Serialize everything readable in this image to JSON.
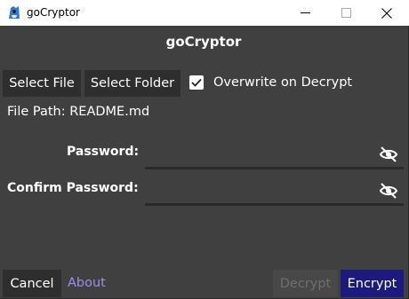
{
  "window": {
    "title": "goCryptor",
    "controls": {
      "minimize_icon": "minimize-icon",
      "maximize_icon": "maximize-icon",
      "close_icon": "close-icon"
    }
  },
  "header": {
    "title": "goCryptor"
  },
  "toolbar": {
    "select_file_label": "Select File",
    "select_folder_label": "Select Folder",
    "overwrite_checkbox": {
      "label": "Overwrite on Decrypt",
      "checked": true
    }
  },
  "file_path": {
    "text": "File Path: README.md"
  },
  "form": {
    "password_label": "Password:",
    "password_value": "",
    "confirm_password_label": "Confirm Password:",
    "confirm_password_value": "",
    "visibility_icon": "eye-slash-icon"
  },
  "footer": {
    "cancel_label": "Cancel",
    "about_label": "About",
    "decrypt_label": "Decrypt",
    "encrypt_label": "Encrypt"
  },
  "colors": {
    "background": "#404040",
    "button": "#2e2e2e",
    "primary": "#1c1a7e",
    "link": "#9c8fe8",
    "disabled_bg": "#484848",
    "disabled_text": "#6f6f6f"
  }
}
